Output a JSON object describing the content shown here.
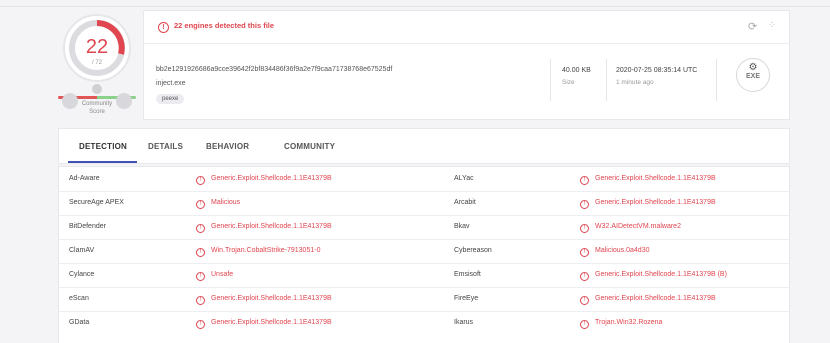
{
  "score": {
    "detected": "22",
    "total": "/ 72",
    "color": "#e0464f"
  },
  "community": {
    "label": "Community Score"
  },
  "alert": {
    "text": "22 engines detected this file"
  },
  "file": {
    "hash": "bb2e1291926686a9cce39642f2bf834486f36f9a2e7f9caa71738768e67525df",
    "name": "inject.exe",
    "tag": "peexe",
    "size": "40.00 KB",
    "size_label": "Size",
    "date": "2020-07-25 08:35:14 UTC",
    "date_ago": "1 minute ago",
    "type_label": "EXE"
  },
  "tabs": [
    "DETECTION",
    "DETAILS",
    "BEHAVIOR",
    "COMMUNITY"
  ],
  "rows": [
    {
      "e1": "Ad-Aware",
      "d1": "Generic.Exploit.Shellcode.1.1E41379B",
      "e2": "ALYac",
      "d2": "Generic.Exploit.Shellcode.1.1E41379B"
    },
    {
      "e1": "SecureAge APEX",
      "d1": "Malicious",
      "e2": "Arcabit",
      "d2": "Generic.Exploit.Shellcode.1.1E41379B"
    },
    {
      "e1": "BitDefender",
      "d1": "Generic.Exploit.Shellcode.1.1E41379B",
      "e2": "Bkav",
      "d2": "W32.AIDetectVM.malware2"
    },
    {
      "e1": "ClamAV",
      "d1": "Win.Trojan.CobaltStrike-7913051-0",
      "e2": "Cybereason",
      "d2": "Malicious.0a4d30"
    },
    {
      "e1": "Cylance",
      "d1": "Unsafe",
      "e2": "Emsisoft",
      "d2": "Generic.Exploit.Shellcode.1.1E41379B (B)"
    },
    {
      "e1": "eScan",
      "d1": "Generic.Exploit.Shellcode.1.1E41379B",
      "e2": "FireEye",
      "d2": "Generic.Exploit.Shellcode.1.1E41379B"
    },
    {
      "e1": "GData",
      "d1": "Generic.Exploit.Shellcode.1.1E41379B",
      "e2": "Ikarus",
      "d2": "Trojan.Win32.Rozena"
    }
  ]
}
